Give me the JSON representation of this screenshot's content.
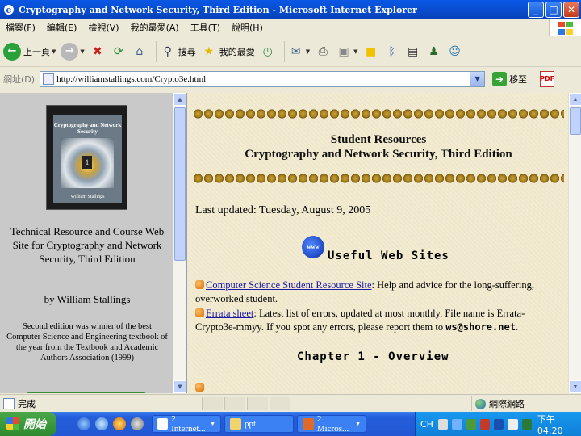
{
  "window": {
    "title": "Cryptography and Network Security, Third Edition - Microsoft Internet Explorer"
  },
  "menu": [
    "檔案(F)",
    "編輯(E)",
    "檢視(V)",
    "我的最愛(A)",
    "工具(T)",
    "說明(H)"
  ],
  "toolbar": {
    "back": "上一頁",
    "search": "搜尋",
    "favorites": "我的最愛"
  },
  "address": {
    "label": "網址(D)",
    "url": "http://williamstallings.com/Crypto3e.html",
    "go": "移至"
  },
  "left_frame": {
    "cover_title": "Cryptography and Network Security",
    "cover_author": "William Stallings",
    "site_title": "Technical Resource and Course Web Site for Cryptography and Network Security, Third Edition",
    "byline": "by William Stallings",
    "award": "Second edition was winner of the best Computer Science and Engineering textbook of the year from the Textbook and Academic Authors Association (1999)"
  },
  "main_frame": {
    "heading1": "Student Resources",
    "heading2": "Cryptography and Network Security, Third Edition",
    "updated": "Last updated: Tuesday, August 9, 2005",
    "www_icon": "www",
    "section1": "Useful Web Sites",
    "item1_link": "Computer Science Student Resource Site",
    "item1_text": ": Help and advice for the long-suffering, overworked student.",
    "item2_link": "Errata sheet",
    "item2_text": ": Latest list of errors, updated at most monthly. File name is Errata-Crypto3e-mmyy. If you spot any errors, please report them to ",
    "item2_email": "ws@shore.net",
    "item2_end": ".",
    "section2": "Chapter 1 - Overview"
  },
  "status": {
    "text": "完成",
    "zone": "網際網路"
  },
  "taskbar": {
    "start": "開始",
    "tasks": [
      "2 Internet...",
      "ppt",
      "2 Micros..."
    ],
    "tray_lang": "CH",
    "clock": "下午 04:20"
  }
}
